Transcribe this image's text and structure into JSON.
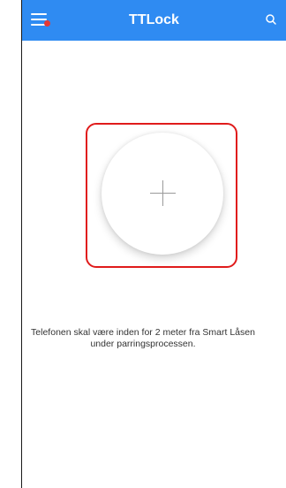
{
  "header": {
    "title": "TTLock",
    "menu_icon": "hamburger-menu-icon",
    "search_icon": "search-icon",
    "bar_color": "#2f8bf2",
    "notification_dot_color": "#e53935"
  },
  "main": {
    "add_button_icon": "plus-icon",
    "highlight_color": "#e01b1b",
    "hint_line1": "Telefonen skal være inden for 2 meter fra Smart Låsen",
    "hint_line2": "under parringsprocessen."
  }
}
